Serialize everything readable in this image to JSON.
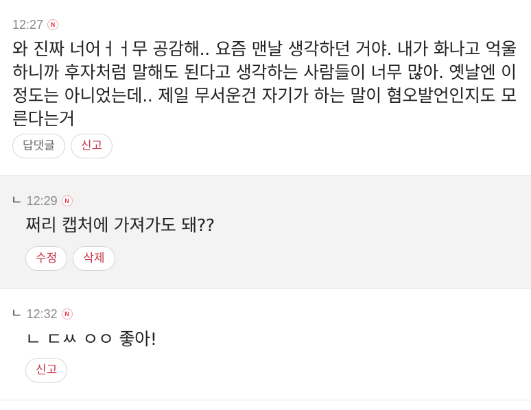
{
  "comments": [
    {
      "time": "12:27",
      "badge": "N",
      "reply_mark": "",
      "text": "와 진짜 너어ㅓㅓ무 공감해.. 요즘 맨날 생각하던 거야. 내가 화나고 억울하니까 후자처럼 말해도 된다고 생각하는 사람들이 너무 많아. 옛날엔 이정도는 아니었는데.. 제일 무서운건 자기가 하는 말이 혐오발언인지도 모른다는거",
      "actions": [
        "답댓글",
        "신고"
      ]
    },
    {
      "time": "12:29",
      "badge": "N",
      "reply_mark": "ㄴ",
      "text": "쩌리 캡처에 가져가도 돼??",
      "actions": [
        "수정",
        "삭제"
      ]
    },
    {
      "time": "12:32",
      "badge": "N",
      "reply_mark": "ㄴ",
      "text": "ㄴ ㄷㅆ ㅇㅇ 좋아!",
      "actions": [
        "신고"
      ]
    }
  ],
  "colors": {
    "accent_red": "#c9374a",
    "badge_red": "#e8364f",
    "reply_background": "#f3f3f3",
    "meta_gray": "#8a8a8a"
  },
  "icons": {
    "badge": "new-badge-icon",
    "reply": "reply-arrow-icon"
  }
}
